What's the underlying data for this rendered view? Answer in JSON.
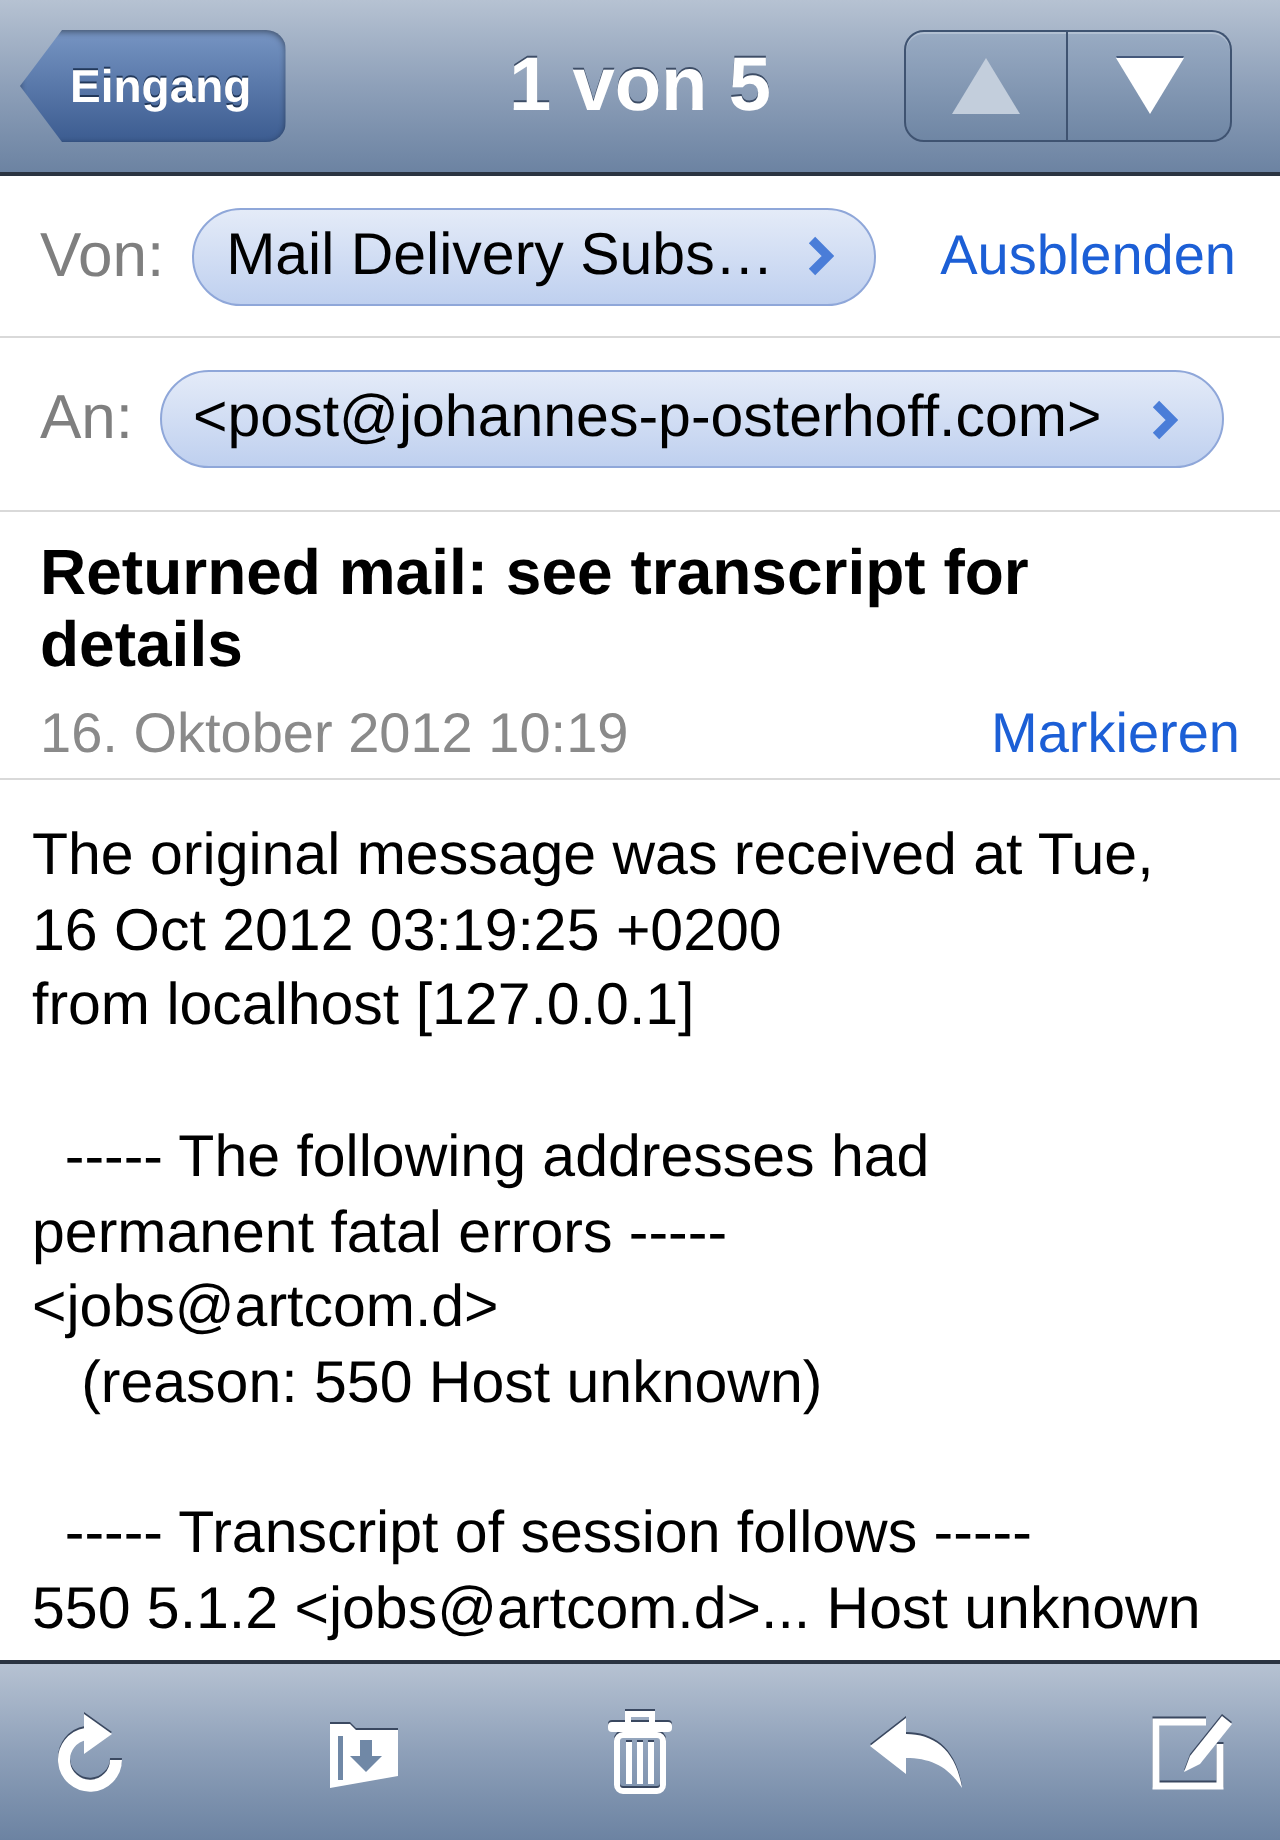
{
  "nav_bar": {
    "back_button": "Eingang",
    "title": "1 von 5",
    "arrows": [
      {
        "kind": "up",
        "disabled": true
      },
      {
        "kind": "down",
        "disabled": false
      }
    ]
  },
  "header": {
    "from": {
      "label": "Von:",
      "sender": "Mail Delivery Subs…",
      "action": "Ausblenden"
    },
    "to": {
      "label": "An:",
      "recipient": "<post@johannes-p-osterhoff.com>"
    }
  },
  "message": {
    "subject": "Returned mail: see transcript for details",
    "date": "16. Oktober 2012 10:19",
    "action": "Markieren"
  },
  "body": {
    "paragraphs": [
      [
        "The original message was received at Tue,",
        "16 Oct 2012 03:19:25 +0200",
        "from localhost [127.0.0.1]"
      ],
      [
        "  ----- The following addresses had",
        "permanent fatal errors -----",
        "<jobs@artcom.d>",
        "   (reason: 550 Host unknown)"
      ],
      [
        "  ----- Transcript of session follows -----",
        "550 5.1.2 <jobs@artcom.d>... Host unknown"
      ]
    ]
  },
  "toolbar": [
    {
      "kind": "refresh"
    },
    {
      "kind": "move"
    },
    {
      "kind": "trash"
    },
    {
      "kind": "reply"
    },
    {
      "kind": "compose"
    }
  ]
}
